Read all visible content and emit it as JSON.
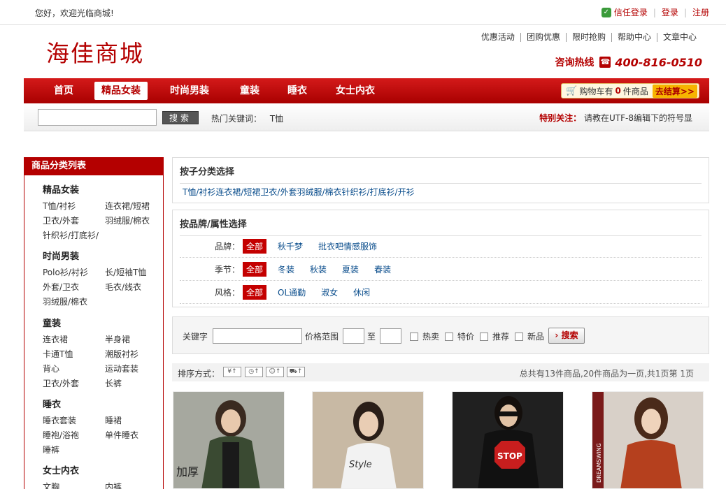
{
  "topbar": {
    "welcome": "您好，欢迎光临商城!",
    "trust_login": "信任登录",
    "login": "登录",
    "register": "注册"
  },
  "header": {
    "logo": "海佳商城",
    "nav": [
      "优惠活动",
      "团购优惠",
      "限时抢购",
      "帮助中心",
      "文章中心"
    ],
    "hotline_label": "咨询热线",
    "hotline_number": "400-816-0510"
  },
  "mainnav": {
    "tabs": [
      "首页",
      "精品女装",
      "时尚男装",
      "童装",
      "睡衣",
      "女士内衣"
    ],
    "active": "精品女装",
    "cart_prefix": "购物车有",
    "cart_count": "0",
    "cart_suffix": "件商品",
    "checkout": "去结算>>"
  },
  "search": {
    "button": "搜索",
    "hot_label": "热门关键词：",
    "hot_keyword": "T恤",
    "notice_label": "特别关注：",
    "notice_text": "请教在UTF-8编辑下的符号显"
  },
  "sidebar": {
    "title": "商品分类列表",
    "categories": [
      {
        "title": "精品女装",
        "items": [
          "T恤/衬衫",
          "连衣裙/短裙",
          "卫衣/外套",
          "羽绒服/棉衣",
          "针织衫/打底衫/"
        ]
      },
      {
        "title": "时尚男装",
        "items": [
          "Polo衫/衬衫",
          "长/短袖T恤",
          "外套/卫衣",
          "毛衣/线衣",
          "羽绒服/棉衣"
        ]
      },
      {
        "title": "童装",
        "items": [
          "连衣裙",
          "半身裙",
          "卡通T恤",
          "潮版衬衫",
          "背心",
          "运动套装",
          "卫衣/外套",
          "长裤"
        ]
      },
      {
        "title": "睡衣",
        "items": [
          "睡衣套装",
          "睡裙",
          "睡袍/浴袍",
          "单件睡衣",
          "睡裤"
        ]
      },
      {
        "title": "女士内衣",
        "items": [
          "文胸",
          "内裤"
        ]
      }
    ]
  },
  "subcat_panel": {
    "title": "按子分类选择",
    "items": [
      "T恤/衬衫",
      "连衣裙/短裙",
      "卫衣/外套",
      "羽绒服/棉衣",
      "针织衫/打底衫/开衫"
    ]
  },
  "attr_panel": {
    "title": "按品牌/属性选择",
    "rows": [
      {
        "label": "品牌：",
        "all": "全部",
        "options": [
          "秋千梦",
          "批衣吧情感服饰"
        ]
      },
      {
        "label": "季节：",
        "all": "全部",
        "options": [
          "冬装",
          "秋装",
          "夏装",
          "春装"
        ]
      },
      {
        "label": "风格：",
        "all": "全部",
        "options": [
          "OL通勤",
          "淑女",
          "休闲"
        ]
      }
    ]
  },
  "filter": {
    "keyword_label": "关键字",
    "price_label": "价格范围",
    "to": "至",
    "checks": [
      "热卖",
      "特价",
      "推荐",
      "新品"
    ],
    "search_button": "搜索"
  },
  "sort": {
    "label": "排序方式：",
    "summary": "总共有13件商品,20件商品为一页,共1页第   1页"
  },
  "products": [
    {
      "overlay": "加厚",
      "bg": "#8a8f86",
      "cloth": "#3a4a32"
    },
    {
      "overlay": "Style",
      "bg": "#c8b9a4",
      "cloth": "#f2f2f2"
    },
    {
      "overlay": "STOP",
      "bg": "#202020",
      "cloth": "#111111"
    },
    {
      "overlay": "DREAMSWING",
      "bg": "#d8d0c8",
      "cloth": "#b5401e"
    }
  ]
}
